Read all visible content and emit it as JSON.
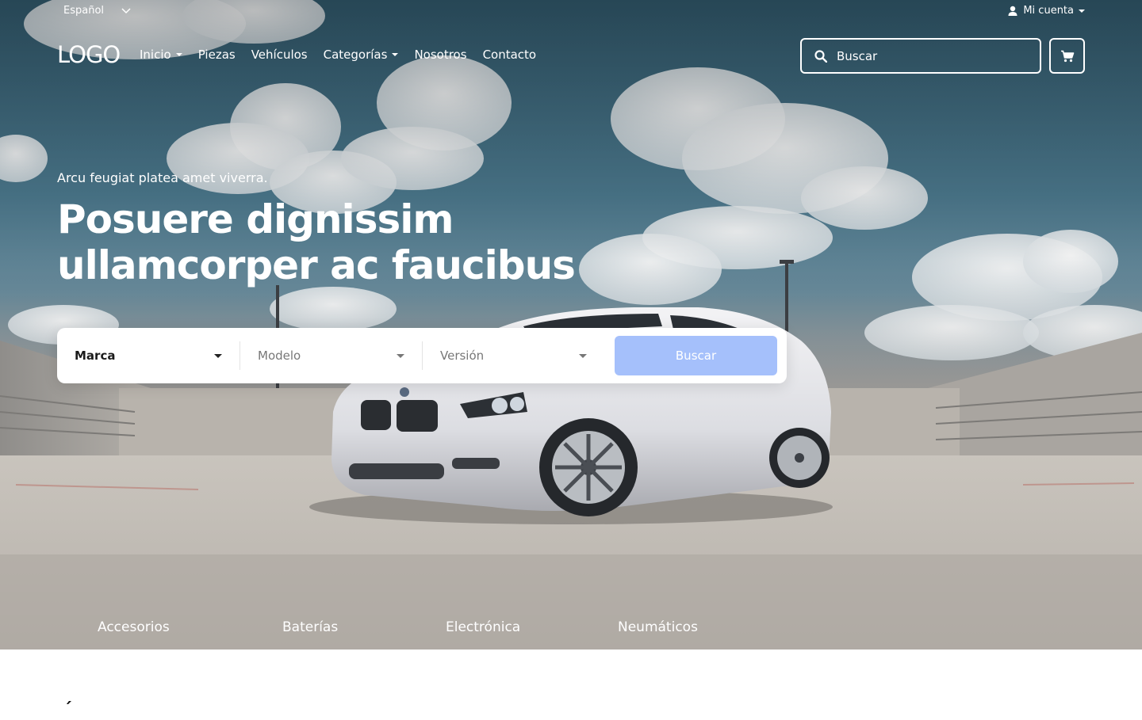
{
  "topbar": {
    "language": "Español",
    "account": "Mi cuenta"
  },
  "nav": {
    "logo": "LOGO",
    "items": [
      {
        "label": "Inicio",
        "dropdown": true
      },
      {
        "label": "Piezas",
        "dropdown": false
      },
      {
        "label": "Vehículos",
        "dropdown": false
      },
      {
        "label": "Categorías",
        "dropdown": true
      },
      {
        "label": "Nosotros",
        "dropdown": false
      },
      {
        "label": "Contacto",
        "dropdown": false
      }
    ],
    "search_placeholder": "Buscar"
  },
  "hero": {
    "eyebrow": "Arcu feugiat platea amet viverra.",
    "headline_line1": "Posuere dignissim",
    "headline_line2": "ullamcorper ac faucibus"
  },
  "finder": {
    "brand": "Marca",
    "model": "Modelo",
    "version": "Versión",
    "button": "Buscar",
    "button_color": "#a5c0fb"
  },
  "categories": [
    "Accesorios",
    "Baterías",
    "Electrónica",
    "Neumáticos"
  ],
  "below": {
    "partial_heading": "´"
  },
  "icons": {
    "language": "chevron-down-icon",
    "account": "user-icon",
    "search": "search-icon",
    "cart": "cart-icon"
  }
}
